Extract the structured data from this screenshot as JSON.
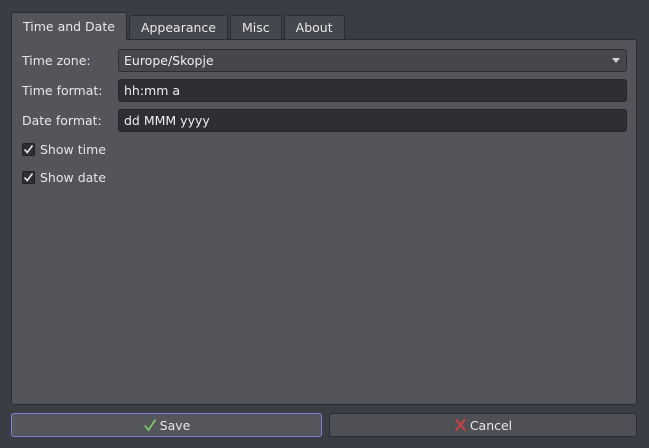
{
  "tabs": [
    {
      "label": "Time and Date",
      "active": true
    },
    {
      "label": "Appearance",
      "active": false
    },
    {
      "label": "Misc",
      "active": false
    },
    {
      "label": "About",
      "active": false
    }
  ],
  "form": {
    "timezone_label": "Time zone:",
    "timezone_value": "Europe/Skopje",
    "time_format_label": "Time format:",
    "time_format_value": "hh:mm a",
    "date_format_label": "Date format:",
    "date_format_value": "dd MMM yyyy",
    "show_time_label": "Show time",
    "show_time_checked": true,
    "show_date_label": "Show date",
    "show_date_checked": true
  },
  "buttons": {
    "save_label": "Save",
    "save_icon": "check-icon",
    "cancel_label": "Cancel",
    "cancel_icon": "cross-icon"
  },
  "colors": {
    "accent": "#7d7fd4",
    "save_icon": "#7cc46a",
    "cancel_icon": "#d04040"
  }
}
